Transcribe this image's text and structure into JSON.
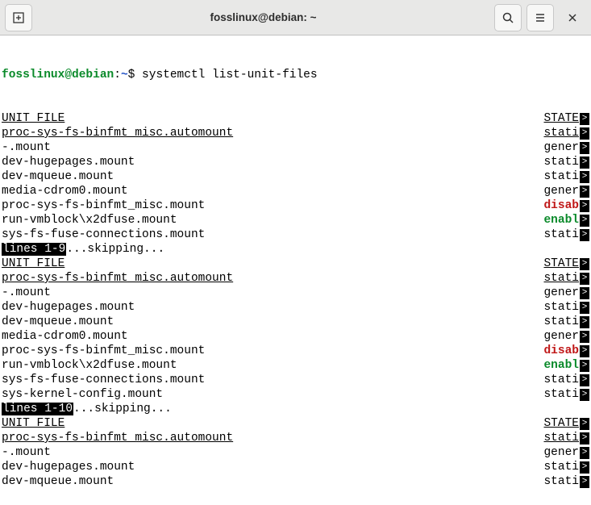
{
  "titlebar": {
    "title": "fosslinux@debian: ~"
  },
  "prompt": {
    "user_host": "fosslinux@debian",
    "sep": ":",
    "path": "~",
    "dollar": "$ ",
    "command": "systemctl list-unit-files"
  },
  "header": {
    "left": "UNIT FILE",
    "right": "STATE"
  },
  "sections": [
    {
      "rows": [
        {
          "left": "proc-sys-fs-binfmt_misc.automount",
          "right": "stati",
          "leftClass": "ul",
          "rightClass": "ul"
        },
        {
          "left": "-.mount",
          "right": "gener",
          "leftClass": "",
          "rightClass": ""
        },
        {
          "left": "dev-hugepages.mount",
          "right": "stati",
          "leftClass": "",
          "rightClass": ""
        },
        {
          "left": "dev-mqueue.mount",
          "right": "stati",
          "leftClass": "",
          "rightClass": ""
        },
        {
          "left": "media-cdrom0.mount",
          "right": "gener",
          "leftClass": "",
          "rightClass": ""
        },
        {
          "left": "proc-sys-fs-binfmt_misc.mount",
          "right": "disab",
          "leftClass": "",
          "rightClass": "red"
        },
        {
          "left": "run-vmblock\\x2dfuse.mount",
          "right": "enabl",
          "leftClass": "",
          "rightClass": "green"
        },
        {
          "left": "sys-fs-fuse-connections.mount",
          "right": "stati",
          "leftClass": "",
          "rightClass": ""
        }
      ],
      "skip": {
        "label": "lines 1-9",
        "suffix": "...skipping..."
      }
    },
    {
      "rows": [
        {
          "left": "proc-sys-fs-binfmt_misc.automount",
          "right": "stati",
          "leftClass": "ul",
          "rightClass": "ul"
        },
        {
          "left": "-.mount",
          "right": "gener",
          "leftClass": "",
          "rightClass": ""
        },
        {
          "left": "dev-hugepages.mount",
          "right": "stati",
          "leftClass": "",
          "rightClass": ""
        },
        {
          "left": "dev-mqueue.mount",
          "right": "stati",
          "leftClass": "",
          "rightClass": ""
        },
        {
          "left": "media-cdrom0.mount",
          "right": "gener",
          "leftClass": "",
          "rightClass": ""
        },
        {
          "left": "proc-sys-fs-binfmt_misc.mount",
          "right": "disab",
          "leftClass": "",
          "rightClass": "red"
        },
        {
          "left": "run-vmblock\\x2dfuse.mount",
          "right": "enabl",
          "leftClass": "",
          "rightClass": "green"
        },
        {
          "left": "sys-fs-fuse-connections.mount",
          "right": "stati",
          "leftClass": "",
          "rightClass": ""
        },
        {
          "left": "sys-kernel-config.mount",
          "right": "stati",
          "leftClass": "",
          "rightClass": ""
        }
      ],
      "skip": {
        "label": "lines 1-10",
        "suffix": "...skipping..."
      }
    },
    {
      "rows": [
        {
          "left": "proc-sys-fs-binfmt_misc.automount",
          "right": "stati",
          "leftClass": "ul",
          "rightClass": "ul"
        },
        {
          "left": "-.mount",
          "right": "gener",
          "leftClass": "",
          "rightClass": ""
        },
        {
          "left": "dev-hugepages.mount",
          "right": "stati",
          "leftClass": "",
          "rightClass": ""
        },
        {
          "left": "dev-mqueue.mount",
          "right": "stati",
          "leftClass": "",
          "rightClass": ""
        }
      ]
    }
  ]
}
